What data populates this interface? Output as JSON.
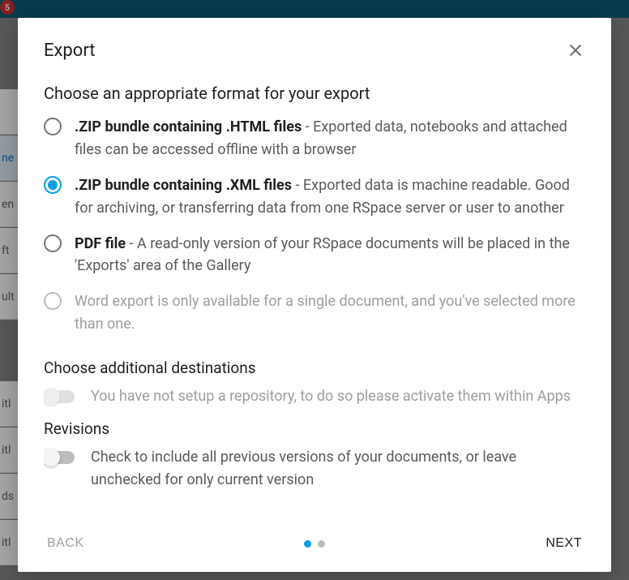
{
  "header": {
    "title": "Export",
    "badge_count": "5"
  },
  "bg_rows": [
    "",
    "ne",
    "en",
    "ft",
    "ult",
    "itl",
    "itl",
    "ds",
    "itl"
  ],
  "sections": {
    "format_heading": "Choose an appropriate format for your export",
    "formats": [
      {
        "id": "html",
        "title": ".ZIP bundle containing .HTML files",
        "desc": " - Exported data, notebooks and attached files can be accessed offline with a browser",
        "selected": false,
        "disabled": false
      },
      {
        "id": "xml",
        "title": ".ZIP bundle containing .XML files",
        "desc": " - Exported data is machine readable. Good for archiving, or transferring data from one RSpace server or user to another",
        "selected": true,
        "disabled": false
      },
      {
        "id": "pdf",
        "title": "PDF file",
        "desc": " - A read-only version of your RSpace documents will be placed in the 'Exports' area of the Gallery",
        "selected": false,
        "disabled": false
      },
      {
        "id": "word",
        "title": "",
        "desc": "Word export is only available for a single document, and you've selected more than one.",
        "selected": false,
        "disabled": true
      }
    ],
    "destinations_heading": "Choose additional destinations",
    "destinations_switch_text": "You have not setup a repository, to do so please activate them within Apps",
    "revisions_heading": "Revisions",
    "revisions_switch_text": "Check to include all previous versions of your documents, or leave unchecked for only current version"
  },
  "footer": {
    "back_label": "BACK",
    "next_label": "NEXT",
    "steps_total": 2,
    "step_active": 1
  }
}
